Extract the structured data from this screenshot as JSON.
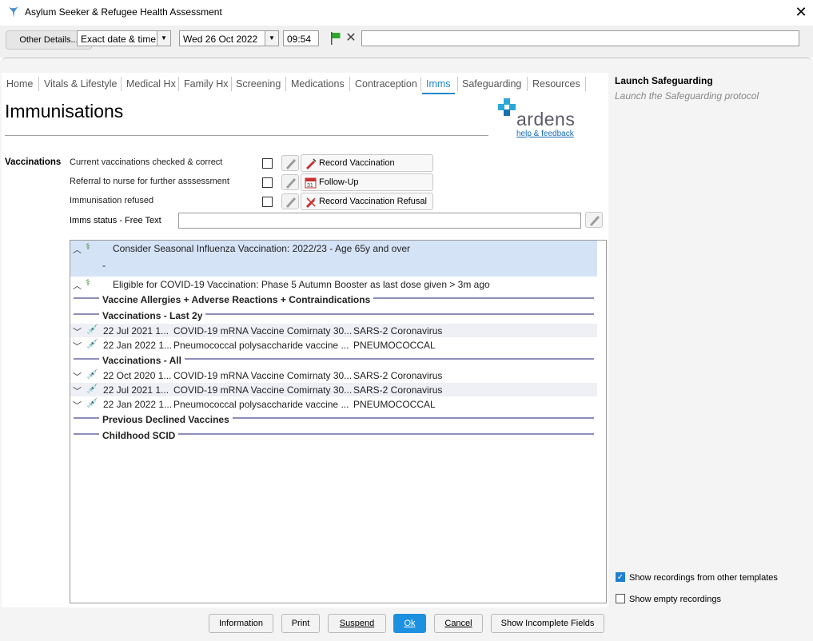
{
  "window": {
    "title": "Asylum Seeker & Refugee Health Assessment"
  },
  "toolbar": {
    "other_details": "Other Details...",
    "date_type": "Exact date & time",
    "date_value": "Wed 26 Oct 2022",
    "time_value": "09:54",
    "free_text": ""
  },
  "tabs": [
    "Home",
    "Vitals & Lifestyle",
    "Medical Hx",
    "Family Hx",
    "Screening",
    "Medications",
    "Contraception",
    "Imms",
    "Safeguarding",
    "Resources"
  ],
  "active_tab": "Imms",
  "page": {
    "heading": "Immunisations",
    "logo_text": "ardens",
    "help_link": "help & feedback"
  },
  "vaccinations": {
    "section_label": "Vaccinations",
    "rows": [
      {
        "label": "Current vaccinations checked & correct",
        "button": "Record Vaccination"
      },
      {
        "label": "Referral to nurse for further asssessment",
        "button": "Follow-Up"
      },
      {
        "label": "Immunisation refused",
        "button": "Record Vaccination Refusal"
      }
    ],
    "imms_status_label": "Imms status - Free Text",
    "imms_status_value": ""
  },
  "list": {
    "alerts": [
      {
        "text": "Consider Seasonal Influenza Vaccination: 2022/23 - Age 65y and over",
        "sub": "-"
      },
      {
        "text": "Eligible for COVID-19 Vaccination: Phase 5 Autumn Booster as last dose given > 3m ago"
      }
    ],
    "sections": {
      "allergies": "Vaccine Allergies + Adverse Reactions + Contraindications",
      "last2y": "Vaccinations - Last 2y",
      "all": "Vaccinations - All",
      "declined": "Previous Declined Vaccines",
      "scid": "Childhood SCID"
    },
    "last2y_items": [
      {
        "date": "22 Jul 2021 1...",
        "vaccine": "COVID-19 mRNA Vaccine Comirnaty 30...",
        "disease": "SARS-2 Coronavirus"
      },
      {
        "date": "22 Jan 2022 1...",
        "vaccine": "Pneumococcal polysaccharide vaccine ...",
        "disease": "PNEUMOCOCCAL"
      }
    ],
    "all_items": [
      {
        "date": "22 Oct 2020 1...",
        "vaccine": "COVID-19 mRNA Vaccine Comirnaty 30...",
        "disease": "SARS-2 Coronavirus"
      },
      {
        "date": "22 Jul 2021 1...",
        "vaccine": "COVID-19 mRNA Vaccine Comirnaty 30...",
        "disease": "SARS-2 Coronavirus"
      },
      {
        "date": "22 Jan 2022 1...",
        "vaccine": "Pneumococcal polysaccharide vaccine ...",
        "disease": "PNEUMOCOCCAL"
      }
    ]
  },
  "right_panel": {
    "launch_title": "Launch Safeguarding",
    "launch_desc": "Launch the Safeguarding protocol",
    "show_other_templates": "Show recordings from other templates",
    "show_other_templates_checked": true,
    "show_empty": "Show empty recordings",
    "show_empty_checked": false
  },
  "buttons": {
    "information": "Information",
    "print": "Print",
    "suspend": "Suspend",
    "ok": "Ok",
    "cancel": "Cancel",
    "show_incomplete": "Show Incomplete Fields"
  },
  "colors": {
    "accent": "#1e88c8",
    "ok_button": "#1e90e0",
    "highlight_row": "#d5e3f7",
    "section_line": "#8d8dbb"
  }
}
